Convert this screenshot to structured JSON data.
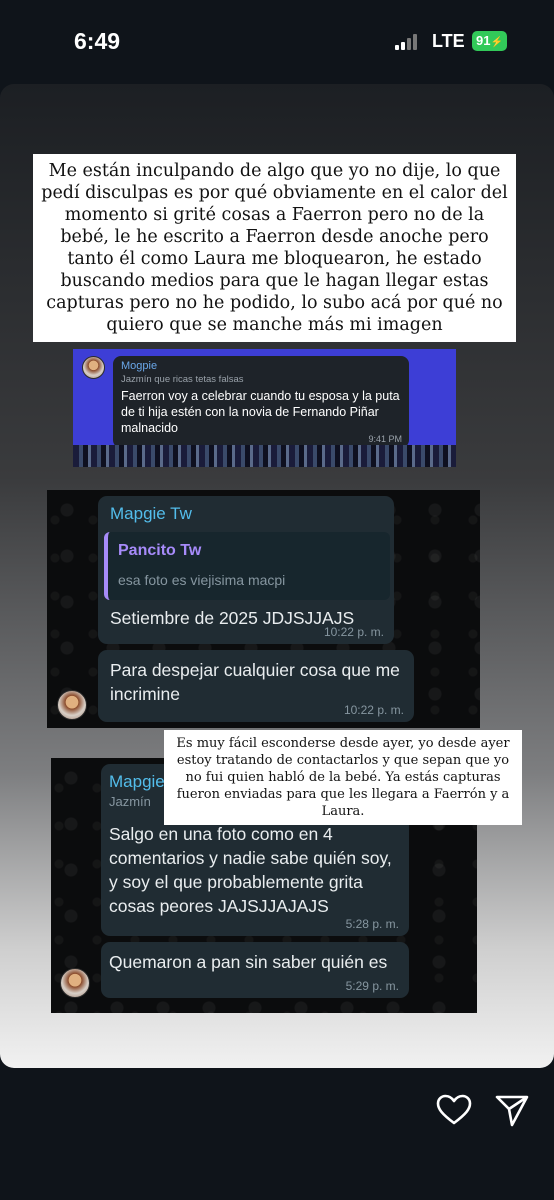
{
  "status_bar": {
    "time": "6:49",
    "network": "LTE",
    "battery": "91"
  },
  "header_note": "Me están inculpando de algo que yo no dije, lo que pedí disculpas es por qué obviamente en el calor del momento si grité cosas a Faerron pero no de la bebé, le he escrito a Faerron desde anoche pero tanto él como Laura me bloquearon, he estado buscando medios para que le hagan llegar estas capturas pero no he podido, lo subo acá por qué no quiero que se manche más mi imagen",
  "telegram_shot": {
    "sender": "Mogpie",
    "quote": "Jazmín que ricas tetas falsas",
    "text": "Faerron voy a celebrar cuando tu esposa y la puta de ti hija estén con la novia de Fernando Piñar malnacido",
    "time": "9:41 PM"
  },
  "whatsapp_shot_1": {
    "sender": "Mapgie Tw",
    "reply_name": "Pancito Tw",
    "reply_text": "esa foto es viejisima macpi",
    "msg1": "Setiembre de 2025 JDJSJJAJS",
    "time1": "10:22 p. m.",
    "msg2": "Para despejar cualquier cosa que me incrimine",
    "time2": "10:22 p. m."
  },
  "middle_note": "Es muy fácil esconderse desde ayer, yo desde ayer estoy tratando de contactarlos y que sepan que yo no fui quien habló de la bebé. Ya estás capturas fueron enviadas para que les llegara a Faerrón y a Laura.",
  "whatsapp_shot_2": {
    "sender": "Mapgie",
    "quote": "Jazmín",
    "msg1": "Salgo en una foto como en 4 comentarios y nadie sabe quién soy, y soy el que probablemente grita cosas peores JAJSJJAJAJS",
    "time1": "5:28 p. m.",
    "msg2": "Quemaron a pan sin saber quién es",
    "time2": "5:29 p. m."
  },
  "actions": {
    "like_icon": "heart-icon",
    "share_icon": "send-icon"
  }
}
